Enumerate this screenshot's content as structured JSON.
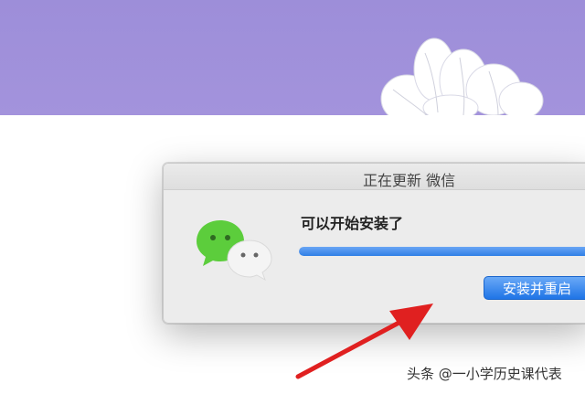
{
  "dialog": {
    "title": "正在更新 微信",
    "message": "可以开始安装了",
    "progress": 1.0,
    "install_button": "安装并重启"
  },
  "watermark": {
    "text": "头条 @一小学历史课代表"
  },
  "colors": {
    "banner": "#a393dc",
    "progress": "#2f7fe6",
    "arrow": "#e02020",
    "wechat_green": "#5ccd3c"
  },
  "icons": [
    "wechat-logo-icon",
    "annotation-arrow",
    "flower-image"
  ]
}
